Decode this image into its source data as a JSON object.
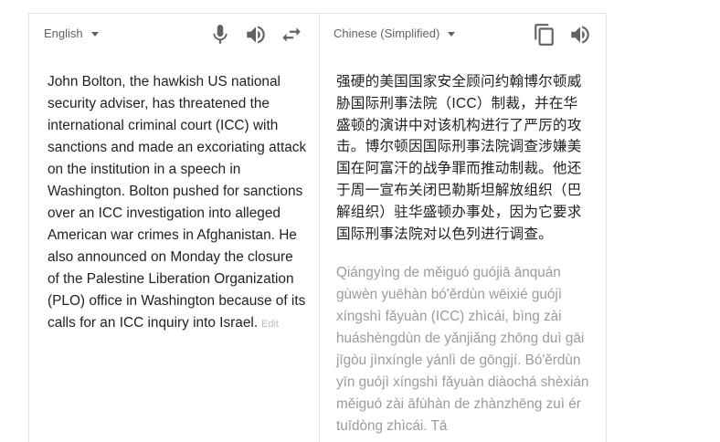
{
  "source": {
    "language": "English",
    "text": "John Bolton, the hawkish US national security adviser, has threatened the international criminal court (ICC) with sanctions and made an excoriating attack on the institution in a speech in Washington. Bolton pushed for sanctions over an ICC investigation into alleged American war crimes in Afghanistan. He also announced on Monday the closure of the Palestine Liberation Organization (PLO) office in Washington because of its calls for an ICC inquiry into Israel.",
    "edit_label": "Edit",
    "icons": [
      "microphone-icon",
      "speaker-icon",
      "swap-languages-icon"
    ]
  },
  "target": {
    "language": "Chinese (Simplified)",
    "translation": "强硬的美国国家安全顾问约翰博尔顿威胁国际刑事法院（ICC）制裁，并在华盛顿的演讲中对该机构进行了严厉的攻击。博尔顿因国际刑事法院调查涉嫌美国在阿富汗的战争罪而推动制裁。他还于周一宣布关闭巴勒斯坦解放组织（巴解组织）驻华盛顿办事处，因为它要求国际刑事法院对以色列进行调查。",
    "romanization": "Qiángyìng de měiguó guójiā ānquán gùwèn yuēhàn bó'ěrdùn wēixié guójì xíngshì fǎyuàn (ICC) zhìcái, bìng zài huáshèngdùn de yǎnjiǎng zhōng duì gāi jīgòu jìnxíngle yánlì de gōngjí. Bó'ěrdùn yīn guójì xíngshì fǎyuàn diàochá shèxián měiguó zài āfùhàn de zhànzhēng zuì ér tuīdòng zhìcái. Tā",
    "icons": [
      "copy-icon",
      "speaker-icon"
    ]
  },
  "colors": {
    "border": "#e3e3e3",
    "icon": "#5f6368",
    "pinyin": "#9b9b9b",
    "text": "#222222"
  }
}
